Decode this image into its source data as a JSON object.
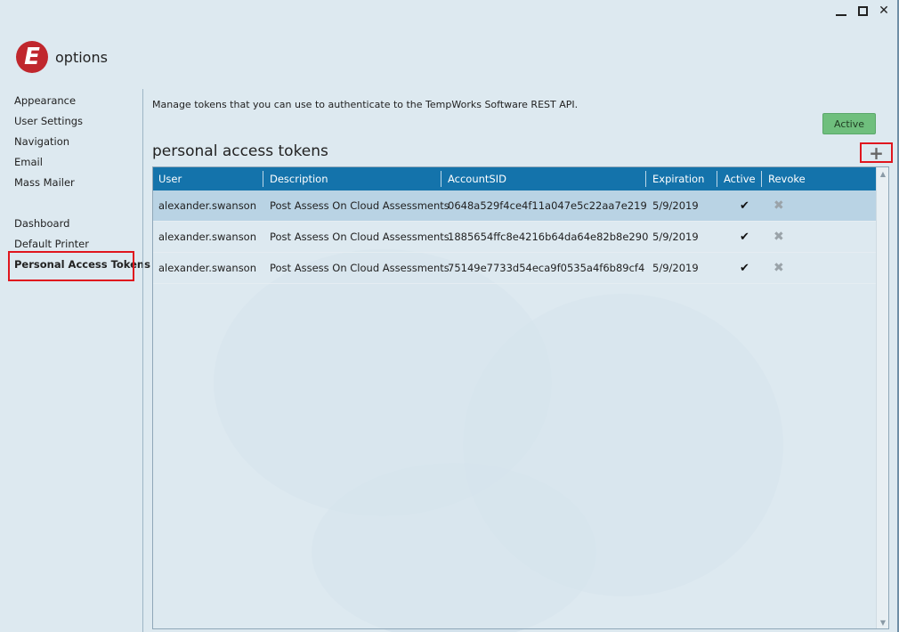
{
  "window": {
    "minimize_label": "",
    "maximize_label": "",
    "close_label": "✕"
  },
  "brand": {
    "logo_letter": "E",
    "title": "options",
    "logo_color": "#c0272d"
  },
  "sidebar": {
    "group1": [
      "Appearance",
      "User Settings",
      "Navigation",
      "Email",
      "Mass Mailer"
    ],
    "group2": [
      "Dashboard",
      "Default Printer",
      "Personal Access Tokens"
    ],
    "active_item": "Personal Access Tokens"
  },
  "main": {
    "intro": "Manage tokens that you can use to authenticate to the TempWorks Software REST API.",
    "active_button": "Active",
    "section_title": "personal access tokens",
    "add_button": "+",
    "columns": [
      "User",
      "Description",
      "AccountSID",
      "Expiration",
      "Active",
      "Revoke"
    ],
    "rows": [
      {
        "user": "alexander.swanson",
        "description": "Post Assess On Cloud Assessments",
        "sid": "0648a529f4ce4f11a047e5c22aa7e219",
        "expiration": "5/9/2019",
        "active": "✔",
        "revoke": "✖"
      },
      {
        "user": "alexander.swanson",
        "description": "Post Assess On Cloud Assessments",
        "sid": "1885654ffc8e4216b64da64e82b8e290",
        "expiration": "5/9/2019",
        "active": "✔",
        "revoke": "✖"
      },
      {
        "user": "alexander.swanson",
        "description": "Post Assess On Cloud Assessments",
        "sid": "75149e7733d54eca9f0535a4f6b89cf4",
        "expiration": "5/9/2019",
        "active": "✔",
        "revoke": "✖"
      }
    ],
    "selected_row": 0
  },
  "colors": {
    "header_bg": "#1473ab",
    "selected_row": "#b9d3e4",
    "highlight": "#e0161e",
    "active_button": "#6fbf7d"
  }
}
